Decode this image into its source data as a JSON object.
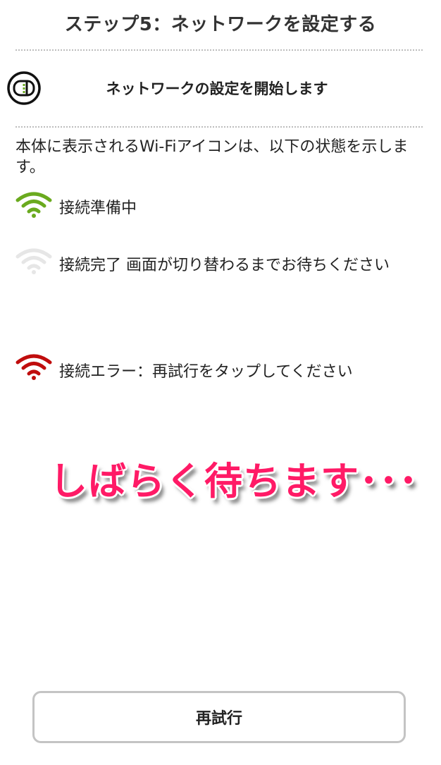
{
  "header": {
    "title": "ステップ5：ネットワークを設定する"
  },
  "step": {
    "icon": "device-icon",
    "heading": "ネットワークの設定を開始します"
  },
  "description": "本体に表示されるWi-Fiアイコンは、以下の状態を示します。",
  "statuses": [
    {
      "icon": "wifi-icon",
      "color": "#6aaa1e",
      "label": "接続準備中"
    },
    {
      "icon": "wifi-icon",
      "color": "#e6e6e6",
      "label": "接続完了 画面が切り替わるまでお待ちください"
    },
    {
      "icon": "wifi-icon",
      "color": "#c00d0d",
      "label": "接続エラー：再試行をタップしてください"
    }
  ],
  "overlay": {
    "text": "しばらく待ちます･･･",
    "color": "#ff1a66"
  },
  "retry_button": {
    "label": "再試行"
  }
}
